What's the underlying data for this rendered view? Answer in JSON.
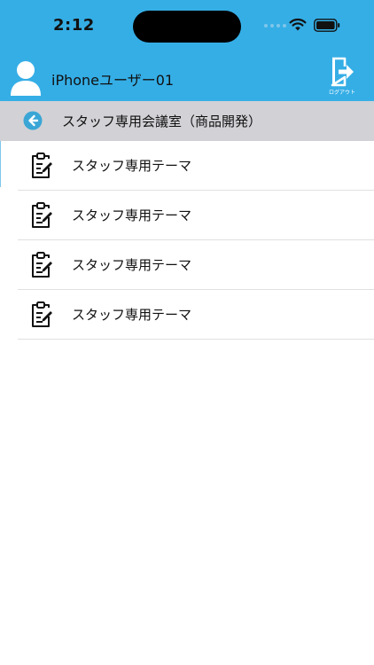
{
  "status_bar": {
    "time": "2:12"
  },
  "header": {
    "user_name": "iPhoneユーザー01",
    "logout_label": "ログアウト",
    "background_color": "#35aee6"
  },
  "subheader": {
    "title": "スタッフ専用会議室（商品開発）",
    "background_color": "#d1d1d6",
    "back_icon_color": "#3aa6d6"
  },
  "topics": [
    {
      "label": "スタッフ専用テーマ",
      "icon": "clipboard-edit-icon"
    },
    {
      "label": "スタッフ専用テーマ",
      "icon": "clipboard-edit-icon"
    },
    {
      "label": "スタッフ専用テーマ",
      "icon": "clipboard-edit-icon"
    },
    {
      "label": "スタッフ専用テーマ",
      "icon": "clipboard-edit-icon"
    }
  ]
}
